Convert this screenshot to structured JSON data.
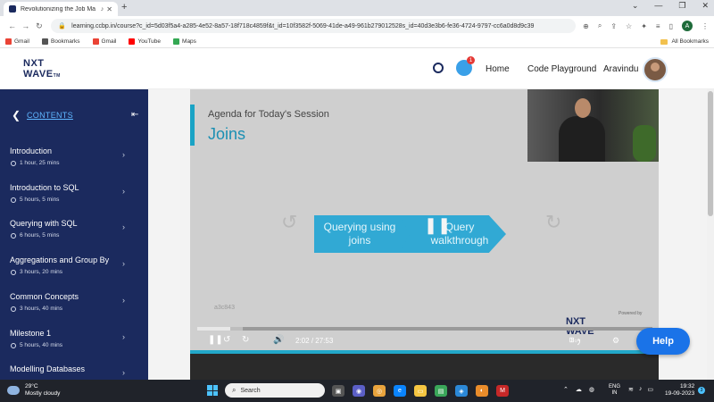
{
  "browser": {
    "tab_title": "Revolutionizing the Job Ma",
    "new_tab": "+",
    "url": "learning.ccbp.in/course?c_id=5d03f5a4-a285-4e52-8a57-18f718c4859f&t_id=10f3582f-5069-41de-a49-961b279012528s_id=40d3e3b6-fe36-4724-9797-cc6a0d8d9c39",
    "profile_initial": "A",
    "bookmarks": [
      {
        "label": "Gmail",
        "color": "#ea4335"
      },
      {
        "label": "Bookmarks",
        "color": "#555555"
      },
      {
        "label": "Gmail",
        "color": "#ea4335"
      },
      {
        "label": "YouTube",
        "color": "#ff0000"
      },
      {
        "label": "Maps",
        "color": "#34a853"
      }
    ],
    "all_bookmarks": "All Bookmarks"
  },
  "header": {
    "logo_line1": "NXT",
    "logo_line2": "WAVE",
    "logo_tm": "TM",
    "notification_count": "1",
    "nav_home": "Home",
    "nav_code": "Code Playground",
    "user_name": "Aravindu"
  },
  "sidebar": {
    "title": "CONTENTS",
    "items": [
      {
        "name": "Introduction",
        "duration": "1 hour, 25 mins"
      },
      {
        "name": "Introduction to SQL",
        "duration": "5 hours, 5 mins"
      },
      {
        "name": "Querying with SQL",
        "duration": "6 hours, 5 mins"
      },
      {
        "name": "Aggregations and Group By",
        "duration": "3 hours, 20 mins"
      },
      {
        "name": "Common Concepts",
        "duration": "3 hours, 40 mins"
      },
      {
        "name": "Milestone 1",
        "duration": "5 hours, 40 mins"
      },
      {
        "name": "Modelling Databases",
        "duration": ""
      }
    ]
  },
  "video": {
    "agenda": "Agenda for Today's Session",
    "topic": "Joins",
    "step1": "Querying using joins",
    "step2": "Query walkthrough",
    "rewind_seconds": "10",
    "forward_seconds": "10",
    "slide_id": "a3c843",
    "brand_line1": "NXT",
    "brand_line2": "WAVE",
    "powered_by": "Powered by",
    "current_time": "2:02",
    "separator": "/",
    "total_time": "27:53",
    "progress_fraction": 0.073,
    "buffered_fraction": 0.1,
    "cc_label": "ꖸ్ర",
    "help_label": "Help"
  },
  "taskbar": {
    "temperature": "29°C",
    "weather": "Mostly cloudy",
    "search_placeholder": "Search",
    "lang_line1": "ENG",
    "lang_line2": "IN",
    "time": "19:32",
    "date": "19-09-2023",
    "notification_count": "3"
  },
  "colors": {
    "sidebar_bg": "#1b2a5e",
    "accent": "#31a9d4",
    "help_button": "#1a73e8"
  }
}
